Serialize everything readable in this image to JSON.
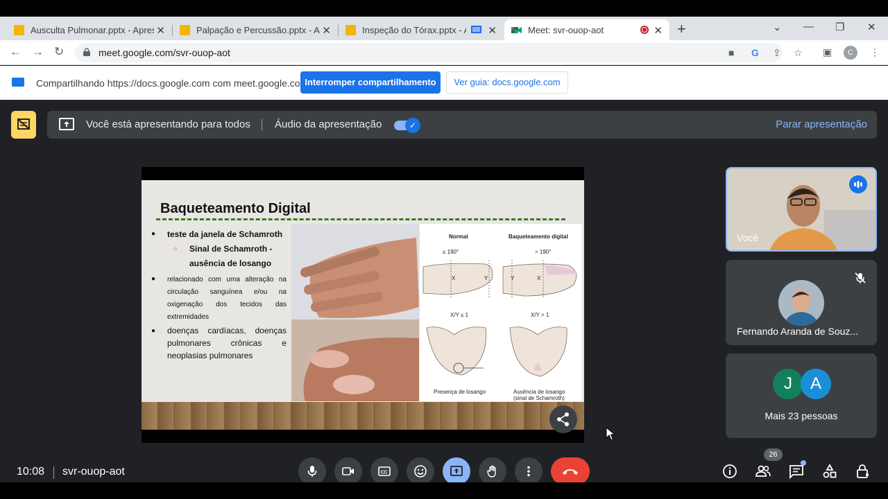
{
  "browser": {
    "tabs": [
      {
        "label": "Ausculta Pulmonar.pptx - Apresentação"
      },
      {
        "label": "Palpação e Percussão.pptx - Apresentação"
      },
      {
        "label": "Inspeção do Tórax.pptx - Apresentação"
      },
      {
        "label": "Meet: svr-ouop-aot"
      }
    ],
    "url": "meet.google.com/svr-ouop-aot",
    "profile_initial": "C"
  },
  "sharebar": {
    "text": "Compartilhando https://docs.google.com com meet.google.com",
    "stop_label": "Interromper compartilhamento",
    "guide_label": "Ver guia: docs.google.com"
  },
  "presenting": {
    "status": "Você está apresentando para todos",
    "audio_label": "Áudio da apresentação",
    "stop_label": "Parar apresentação"
  },
  "slide": {
    "title": "Baqueteamento Digital",
    "bullet1": "teste da janela de Schamroth",
    "bullet1_sub_line1": "Sinal de Schamroth -",
    "bullet1_sub_line2": "ausência de losango",
    "bullet2": "relacionado com uma alteração na circulação sanguínea e/ou na oxigenação dos tecidos das extremidades",
    "bullet3": "doenças cardíacas, doenças pulmonares crônicas e neoplasias pulmonares",
    "diagram": {
      "normal": "Normal",
      "clubbing": "Baqueteamento digital",
      "angle_normal": "≤ 190°",
      "angle_clubbing": "> 190°",
      "ratio_normal": "X/Y ≤ 1",
      "ratio_clubbing": "X/Y > 1",
      "caption_normal": "Presença de losango",
      "caption_clubbing_line1": "Ausência de losango",
      "caption_clubbing_line2": "(sinal de Schamroth)"
    }
  },
  "participants": {
    "self_name": "Você",
    "tile2_name": "Fernando Aranda de Souz...",
    "more_initials": [
      "J",
      "A"
    ],
    "more_label": "Mais 23 pessoas",
    "people_count": "26"
  },
  "footer": {
    "time": "10:08",
    "meeting_code": "svr-ouop-aot"
  },
  "colors": {
    "meet_bg": "#202124",
    "accent_blue": "#1a73e8",
    "present_yellow": "#fdd663",
    "end_red": "#ea4335"
  }
}
